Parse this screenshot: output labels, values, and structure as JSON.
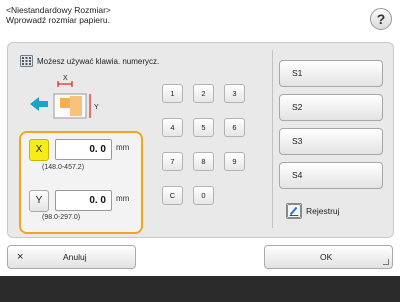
{
  "header": {
    "line1": "<Niestandardowy Rozmiar>",
    "line2": "Wprowadź rozmiar papieru."
  },
  "help": {
    "label": "?"
  },
  "note": {
    "text": "Możesz używać klawia. numerycz."
  },
  "diagram": {
    "x_label": "X",
    "y_label": "Y",
    "accent_color": "#e2231a",
    "arrow_color": "#1aa3c9"
  },
  "x_field": {
    "axis": "X",
    "value": "0. 0",
    "unit": "mm",
    "range": "(148.0-457.2)"
  },
  "y_field": {
    "axis": "Y",
    "value": "0. 0",
    "unit": "mm",
    "range": "(98.0-297.0)"
  },
  "keypad": {
    "keys": [
      "1",
      "2",
      "3",
      "4",
      "5",
      "6",
      "7",
      "8",
      "9",
      "C",
      "0"
    ]
  },
  "stored": {
    "buttons": [
      "S1",
      "S2",
      "S3",
      "S4"
    ],
    "register": "Rejestruj"
  },
  "footer": {
    "cancel": "Anuluj",
    "ok": "OK"
  },
  "colors": {
    "selected_axis": "#f7eb18",
    "focus_border": "#f2a51e",
    "bottom_bar": "#2b2b2b"
  }
}
